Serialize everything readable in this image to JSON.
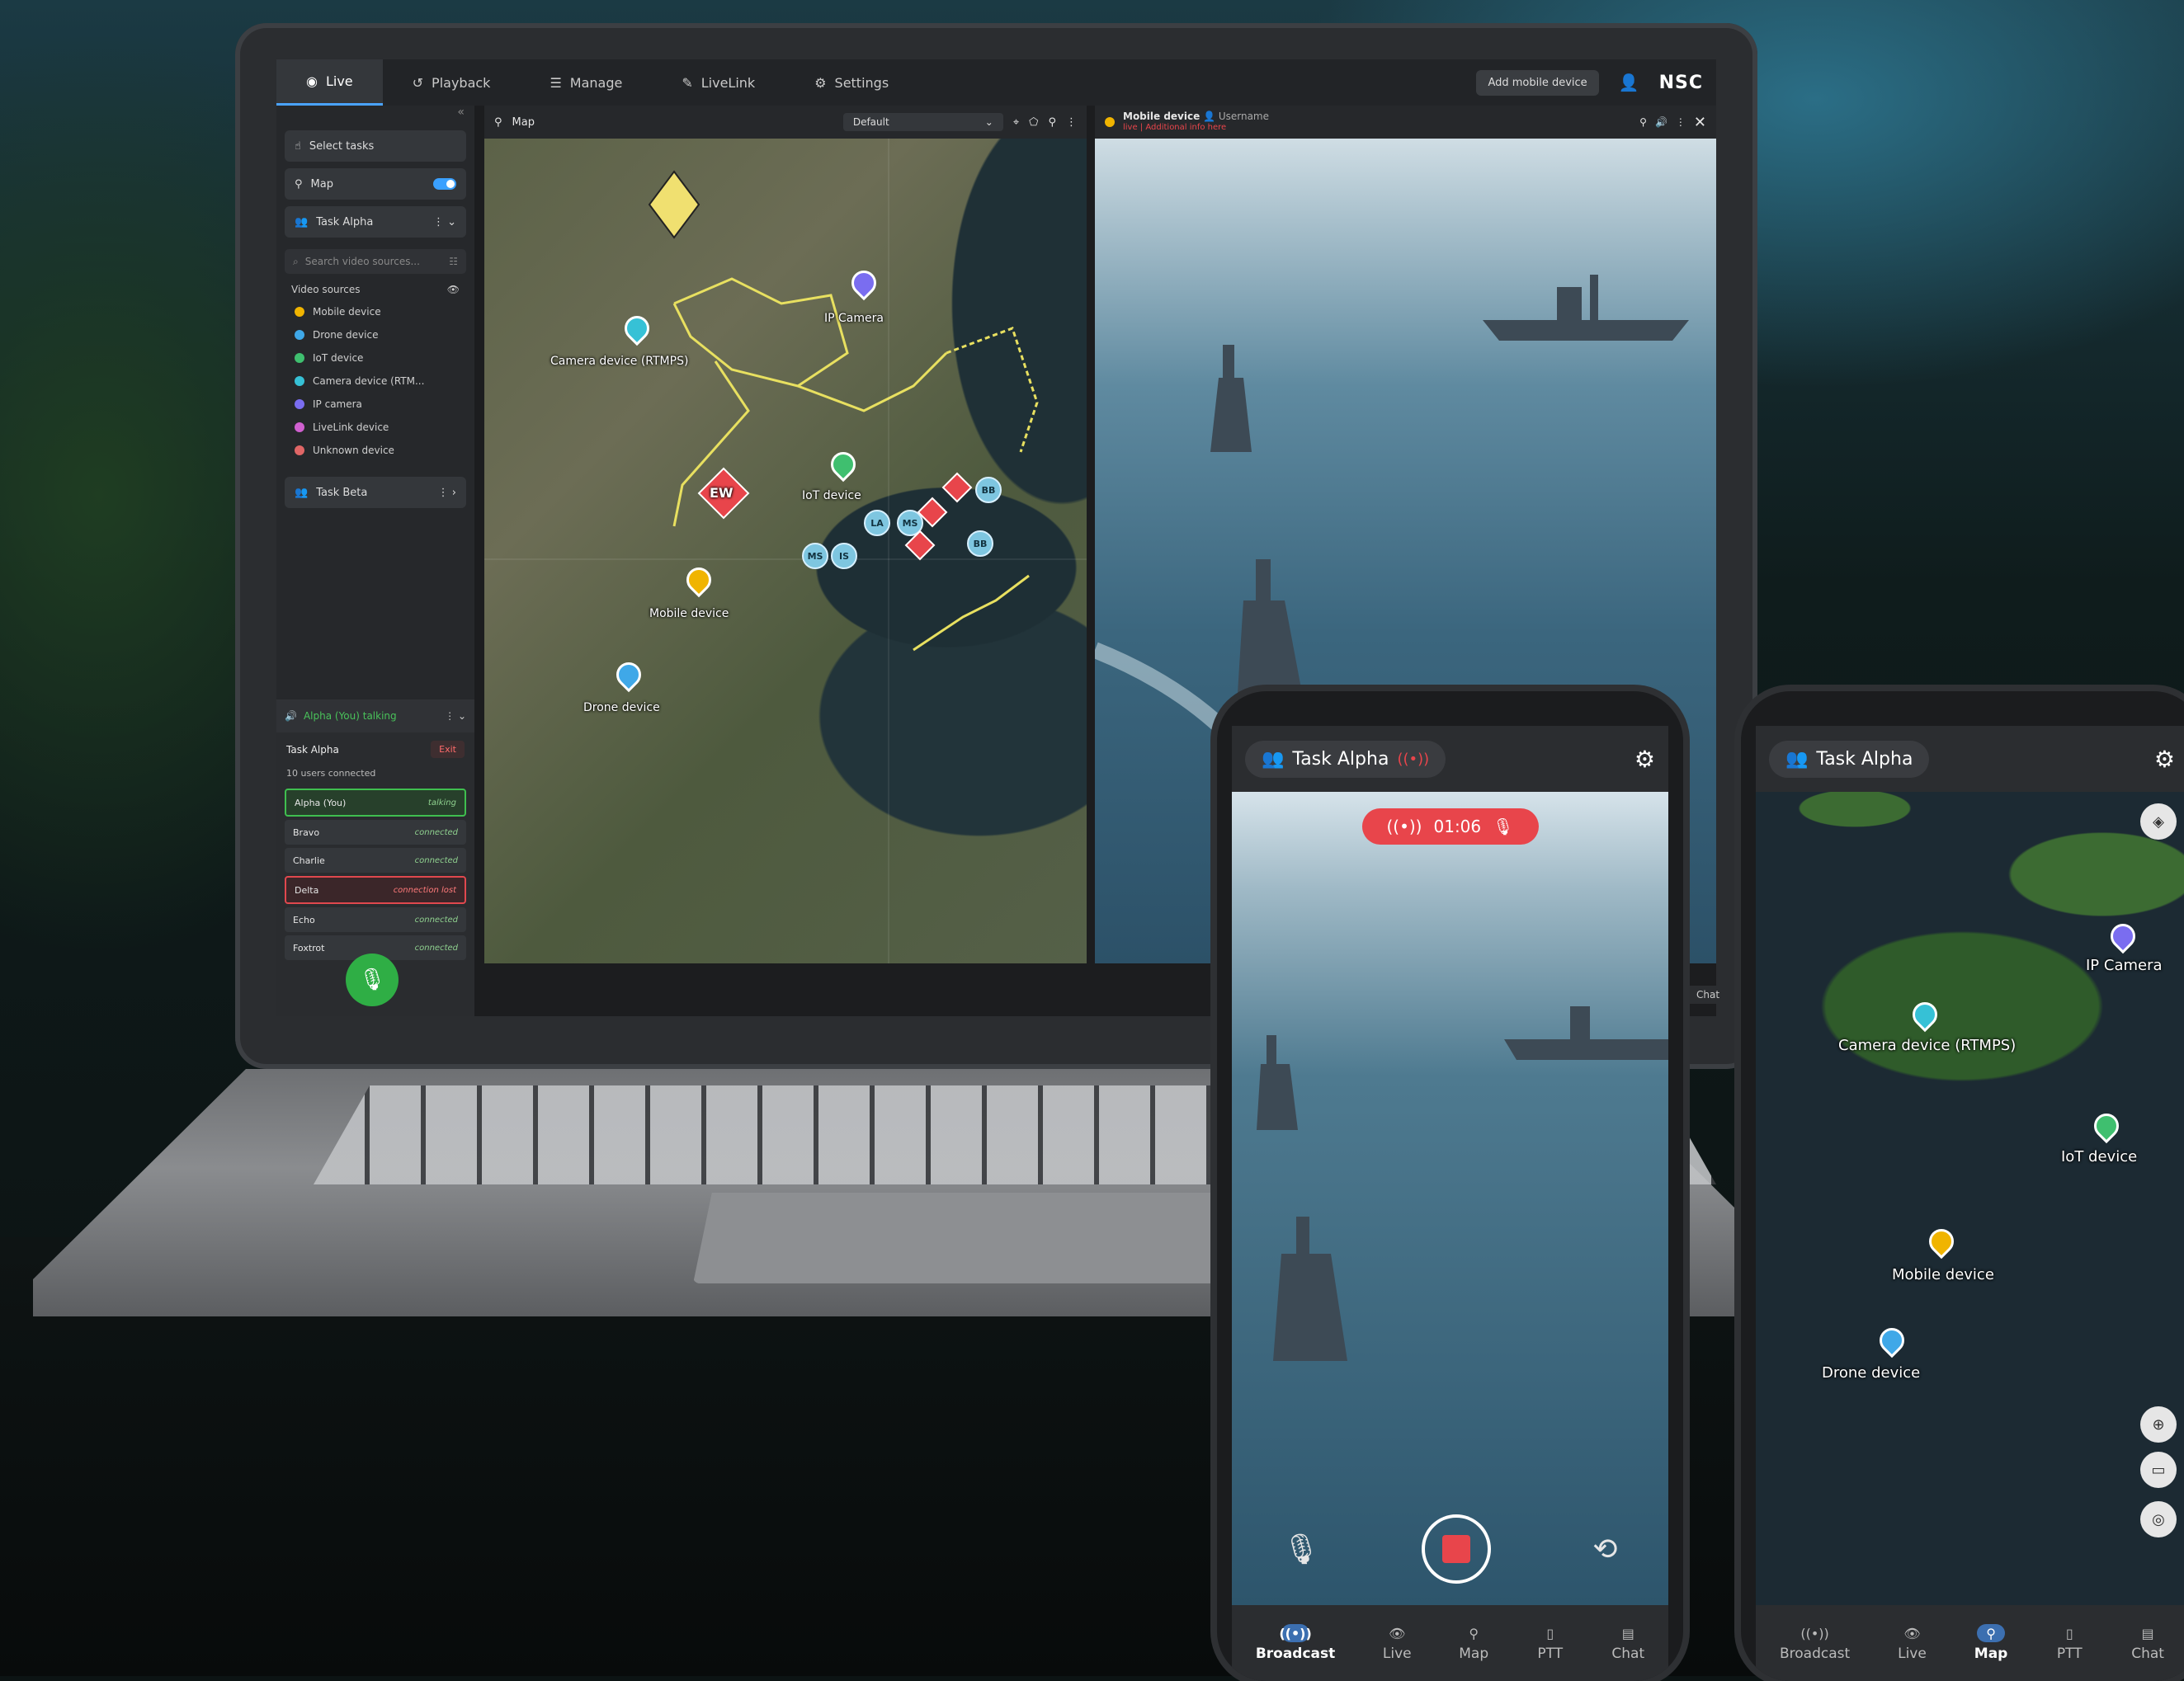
{
  "topbar": {
    "tabs": [
      {
        "label": "Live",
        "icon": "live-icon"
      },
      {
        "label": "Playback",
        "icon": "history-icon"
      },
      {
        "label": "Manage",
        "icon": "list-icon"
      },
      {
        "label": "LiveLink",
        "icon": "link-icon"
      },
      {
        "label": "Settings",
        "icon": "gear-icon"
      }
    ],
    "add_mobile_device": "Add mobile device",
    "logo": "NSC"
  },
  "sidebar": {
    "select_tasks": "Select tasks",
    "map": "Map",
    "task_alpha": "Task Alpha",
    "search_placeholder": "Search video sources...",
    "video_sources_title": "Video sources",
    "video_sources": [
      {
        "label": "Mobile device",
        "color": "#f0b400"
      },
      {
        "label": "Drone device",
        "color": "#3fa8e8"
      },
      {
        "label": "IoT device",
        "color": "#3fbf6f"
      },
      {
        "label": "Camera device (RTM...",
        "color": "#36c1d6"
      },
      {
        "label": "IP camera",
        "color": "#7a6df0"
      },
      {
        "label": "LiveLink device",
        "color": "#d060d0"
      },
      {
        "label": "Unknown device",
        "color": "#e06666"
      }
    ],
    "task_beta": "Task Beta"
  },
  "ptt": {
    "header": "Alpha (You) talking",
    "task": "Task Alpha",
    "exit": "Exit",
    "users_connected": "10 users connected",
    "users": [
      {
        "name": "Alpha (You)",
        "status": "talking",
        "kind": "talking"
      },
      {
        "name": "Bravo",
        "status": "connected",
        "kind": "ok"
      },
      {
        "name": "Charlie",
        "status": "connected",
        "kind": "ok"
      },
      {
        "name": "Delta",
        "status": "connection lost",
        "kind": "lost"
      },
      {
        "name": "Echo",
        "status": "connected",
        "kind": "ok"
      },
      {
        "name": "Foxtrot",
        "status": "connected",
        "kind": "ok"
      }
    ]
  },
  "map_pane": {
    "title": "Map",
    "layer": "Default",
    "labels": {
      "ip_camera": "IP Camera",
      "camera_device": "Camera device (RTMPS)",
      "iot_device": "IoT device",
      "mobile_device": "Mobile device",
      "drone_device": "Drone device",
      "ew": "EW"
    },
    "units": [
      "LA",
      "MS",
      "BB",
      "BB",
      "MS",
      "IS"
    ]
  },
  "video_pane": {
    "device": "Mobile device",
    "username": "Username",
    "meta": "live | Additional info here"
  },
  "phone1": {
    "title": "Task Alpha",
    "timer": "01:06",
    "nav": [
      {
        "label": "Broadcast",
        "icon": "broadcast-icon",
        "active": true
      },
      {
        "label": "Live",
        "icon": "eye-icon",
        "active": false
      },
      {
        "label": "Map",
        "icon": "pin-icon",
        "active": false
      },
      {
        "label": "PTT",
        "icon": "walkie-talkie-icon",
        "active": false
      },
      {
        "label": "Chat",
        "icon": "chat-icon",
        "active": false
      }
    ]
  },
  "phone2": {
    "title": "Task Alpha",
    "labels": {
      "ip_camera": "IP Camera",
      "camera_device": "Camera device (RTMPS)",
      "iot_device": "IoT device",
      "mobile_device": "Mobile device",
      "drone_device": "Drone device"
    },
    "nav": [
      {
        "label": "Broadcast",
        "icon": "broadcast-icon",
        "active": false
      },
      {
        "label": "Live",
        "icon": "eye-icon",
        "active": false
      },
      {
        "label": "Map",
        "icon": "pin-icon",
        "active": true
      },
      {
        "label": "PTT",
        "icon": "walkie-talkie-icon",
        "active": false
      },
      {
        "label": "Chat",
        "icon": "chat-icon",
        "active": false
      }
    ]
  },
  "chat_tab": "Chat",
  "colors": {
    "accent": "#4aa3ff",
    "talking": "#3fbf4f",
    "lost": "#e0484e",
    "record": "#e8454b"
  }
}
